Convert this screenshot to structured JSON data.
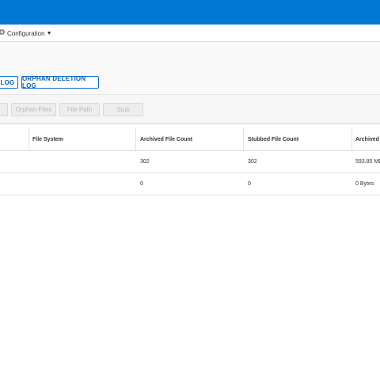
{
  "menu": {
    "configuration_label": "Configuration"
  },
  "logs": {
    "left_label": "LOG",
    "orphan_deletion_label": "ORPHAN DELETION LOG"
  },
  "toolbar": {
    "buttons": [
      "",
      "Orphan Files",
      "File Path",
      "Stub"
    ]
  },
  "table": {
    "columns": [
      "",
      "File System",
      "Archived File Count",
      "Stubbed File Count",
      "Archived Fi"
    ],
    "rows": [
      [
        "",
        "",
        "302",
        "302",
        "593.85 MB"
      ],
      [
        "",
        "",
        "0",
        "0",
        "0 Bytes"
      ]
    ]
  },
  "colors": {
    "header_blue": "#0078d4",
    "button_border": "#0a6ed1"
  }
}
